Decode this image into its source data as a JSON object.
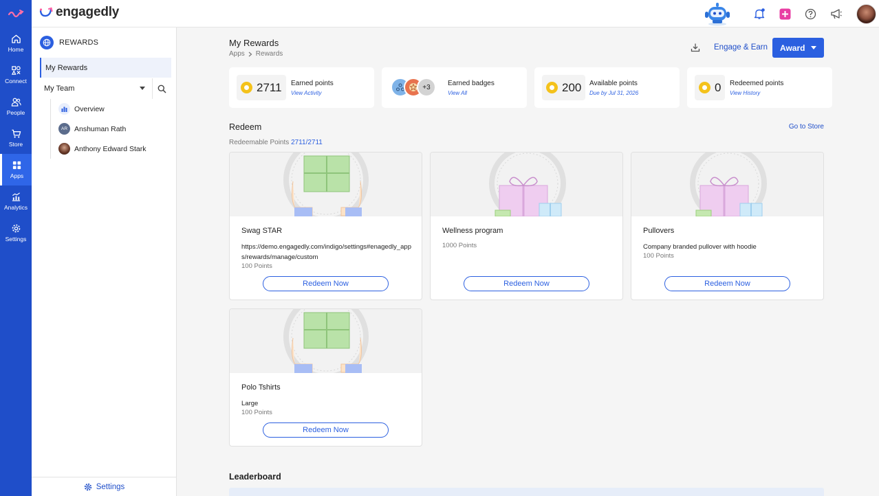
{
  "app": {
    "brand": "engagedly"
  },
  "rail": {
    "items": [
      {
        "label": "Home",
        "icon": "home-icon"
      },
      {
        "label": "Connect",
        "icon": "connect-icon"
      },
      {
        "label": "People",
        "icon": "people-icon"
      },
      {
        "label": "Store",
        "icon": "cart-icon"
      },
      {
        "label": "Apps",
        "icon": "apps-icon",
        "active": true
      },
      {
        "label": "Analytics",
        "icon": "analytics-icon"
      },
      {
        "label": "Settings",
        "icon": "gear-icon"
      }
    ]
  },
  "subnav": {
    "title": "REWARDS",
    "active_item": "My Rewards",
    "my_team": "My Team",
    "team": [
      {
        "label": "Overview",
        "icon": "bar-chart-icon"
      },
      {
        "label": "Anshuman Rath",
        "initials": "AR"
      },
      {
        "label": "Anthony Edward Stark"
      }
    ],
    "footer": "Settings"
  },
  "main": {
    "title": "My Rewards",
    "breadcrumb": [
      "Apps",
      "Rewards"
    ],
    "engage_label": "Engage & Earn",
    "award_label": "Award",
    "stats": [
      {
        "value": "2711",
        "label": "Earned points",
        "link": "View Activity"
      },
      {
        "badges_more": "+3",
        "label": "Earned badges",
        "link": "View All"
      },
      {
        "value": "200",
        "label": "Available points",
        "link": "Due by Jul 31, 2026"
      },
      {
        "value": "0",
        "label": "Redeemed points",
        "link": "View History"
      }
    ],
    "redeem_title": "Redeem",
    "store_link": "Go to Store",
    "redeemable_label": "Redeemable Points",
    "redeemable_value": "2711/2711",
    "rewards": [
      {
        "name": "Swag STAR",
        "desc": "https://demo.engagedly.com/indigo/settings#enagedly_apps/rewards/manage/custom",
        "points": "100 Points",
        "button": "Redeem Now"
      },
      {
        "name": "Wellness program",
        "desc": "",
        "points": "1000 Points",
        "button": "Redeem Now"
      },
      {
        "name": "Pullovers",
        "desc": "Company branded pullover with hoodie",
        "points": "100 Points",
        "button": "Redeem Now"
      },
      {
        "name": "Polo Tshirts",
        "desc": "Large",
        "points": "100 Points",
        "button": "Redeem Now"
      }
    ],
    "leaderboard_title": "Leaderboard"
  },
  "colors": {
    "primary": "#2b5fe0",
    "rail": "#1f4ec9",
    "coin": "#f4c21b"
  }
}
